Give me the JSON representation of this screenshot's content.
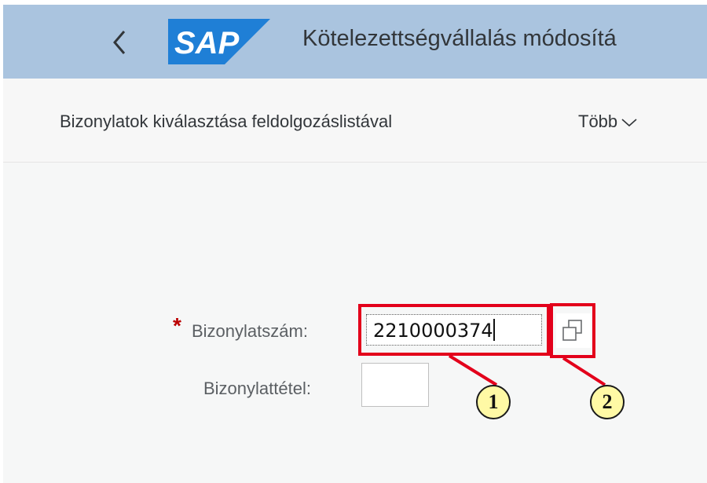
{
  "shell": {
    "back_icon": "chevron-left-icon",
    "logo_text": "SAP",
    "title": "Kötelezettségvállalás módosítá"
  },
  "toolbar": {
    "select_documents": "Bizonylatok kiválasztása feldolgozáslistával",
    "more": "Több",
    "more_icon": "chevron-down-icon"
  },
  "form": {
    "required_marker": "*",
    "document_number_label": "Bizonylatszám:",
    "document_number_value": "2210000374",
    "document_item_label": "Bizonylattétel:",
    "document_item_value": "",
    "value_help_icon": "value-help-icon"
  },
  "annotations": {
    "callout_1": "1",
    "callout_2": "2",
    "color": "#e3001b"
  },
  "colors": {
    "shell_bar": "#aac4df",
    "sap_logo": "#1f7fd6",
    "required": "#bb0000"
  }
}
